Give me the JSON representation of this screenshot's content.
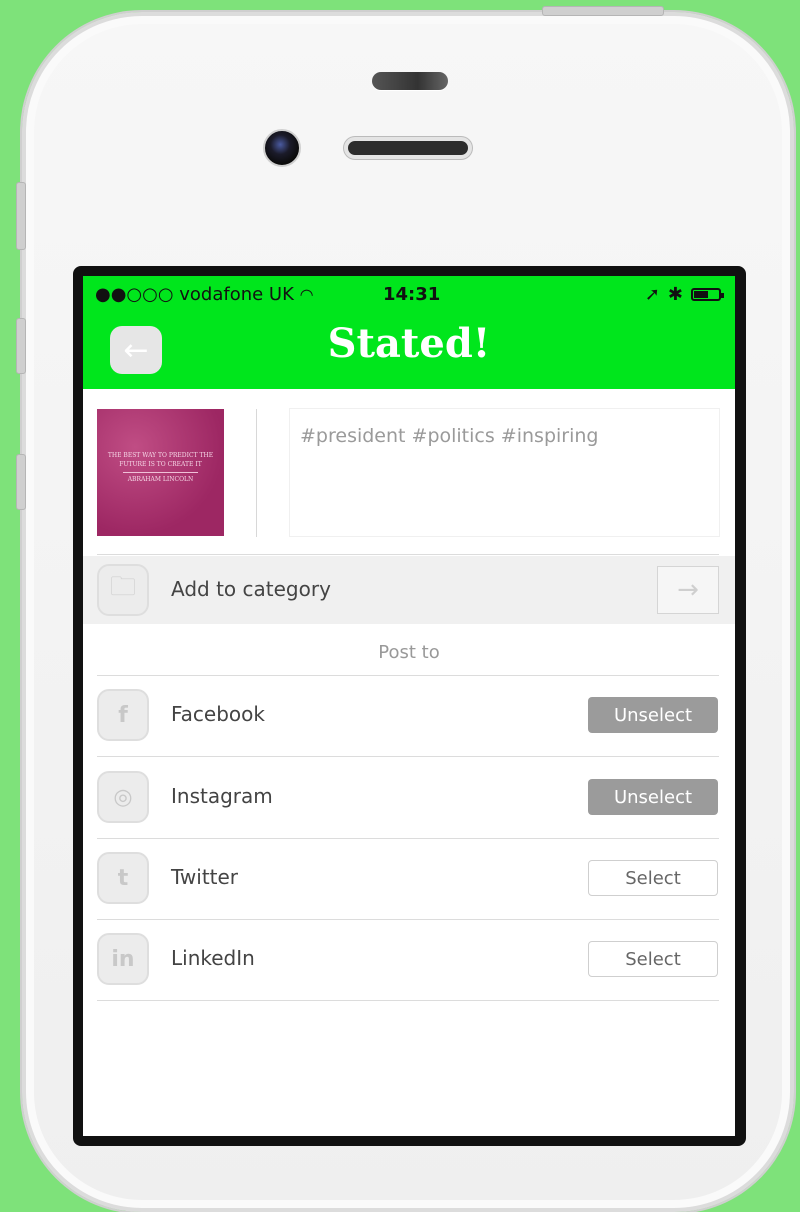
{
  "status_bar": {
    "carrier": "●●○○○ vodafone UK",
    "wifi": "wifi-icon",
    "time": "14:31",
    "location": "➚",
    "bluetooth": "✱"
  },
  "header": {
    "title": "Stated!",
    "back_icon": "←"
  },
  "composer": {
    "thumbnail_text": "THE BEST WAY TO PREDICT THE FUTURE IS TO CREATE IT",
    "thumbnail_author": "ABRAHAM LINCOLN",
    "caption": "#president #politics #inspiring"
  },
  "category": {
    "label": "Add to category",
    "folder_icon": "folder-icon",
    "arrow": "→"
  },
  "post_to": {
    "heading": "Post to",
    "networks": [
      {
        "name": "Facebook",
        "icon": "f",
        "button": "Unselect",
        "selected": true
      },
      {
        "name": "Instagram",
        "icon": "◎",
        "button": "Unselect",
        "selected": true
      },
      {
        "name": "Twitter",
        "icon": "t",
        "button": "Select",
        "selected": false
      },
      {
        "name": "LinkedIn",
        "icon": "in",
        "button": "Select",
        "selected": false
      }
    ]
  },
  "colors": {
    "header_green": "#00e61c",
    "background_green": "#7ee27a",
    "selected_button": "#9b9b9b"
  }
}
